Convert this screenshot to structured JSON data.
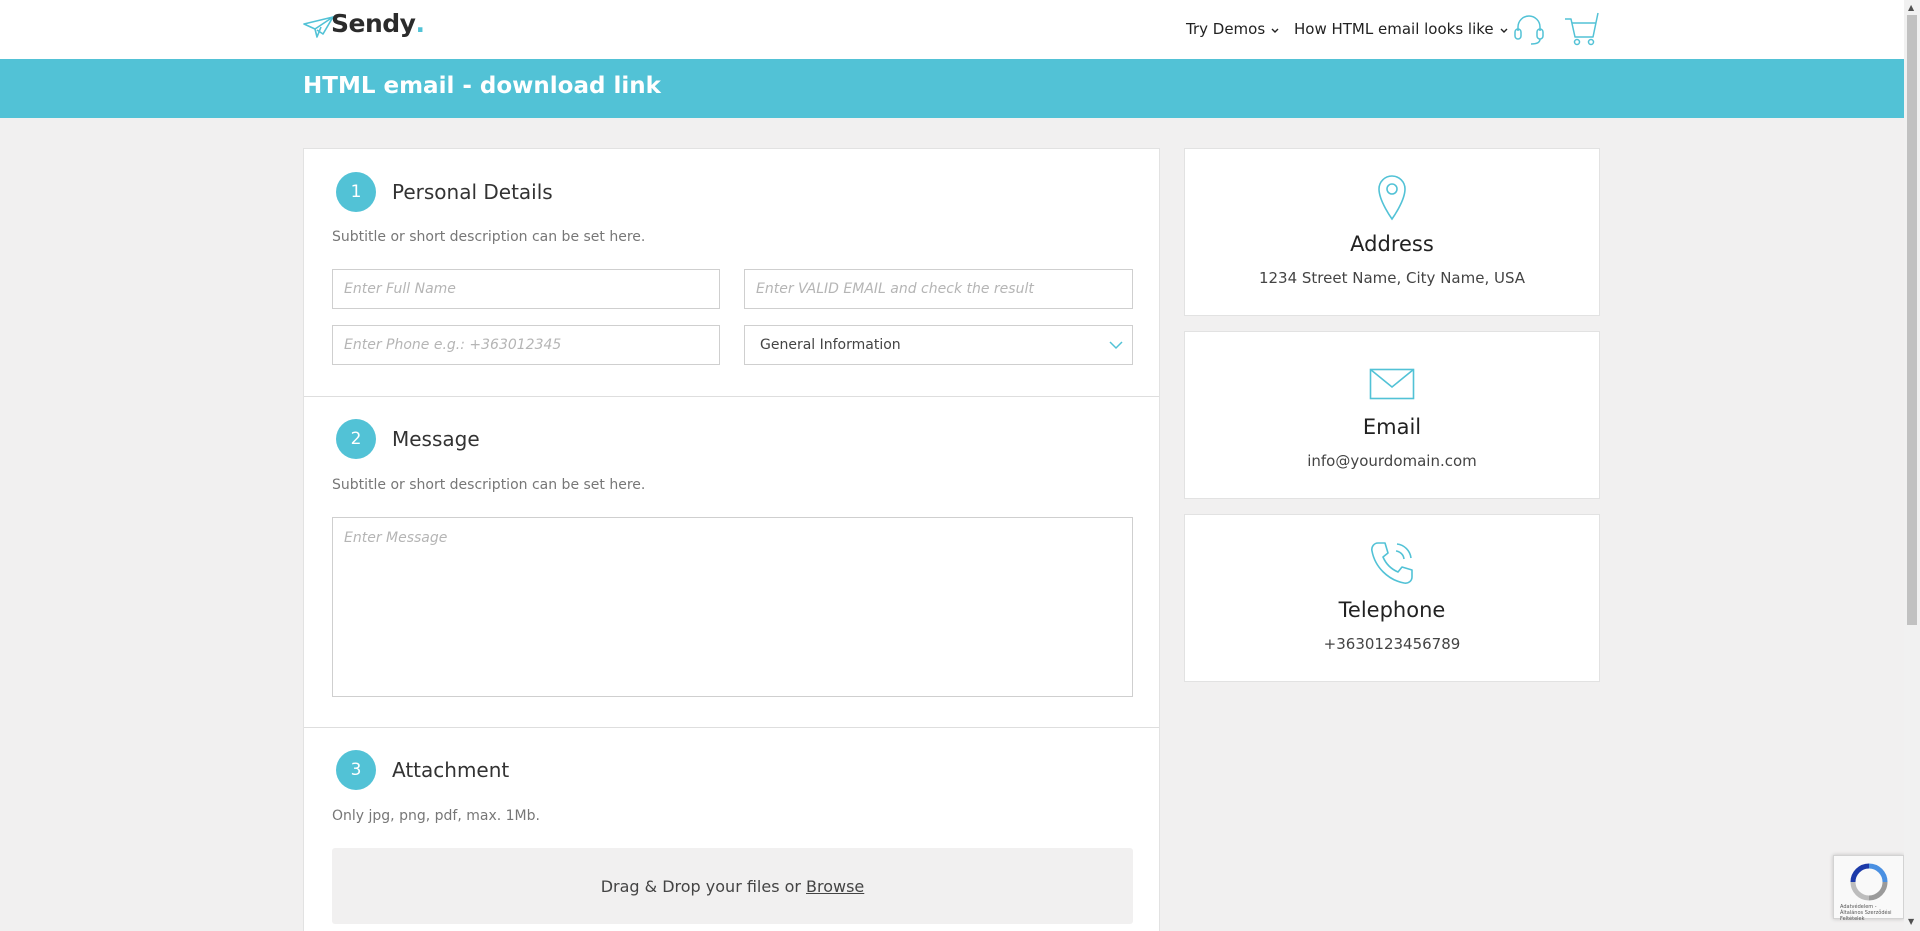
{
  "header": {
    "logo_text": "Sendy",
    "logo_dot": ".",
    "nav": [
      {
        "label": "Try Demos",
        "chevron": "⌄"
      },
      {
        "label": "How HTML email looks like",
        "chevron": "⌄"
      }
    ],
    "icons": [
      "headset-icon",
      "cart-icon"
    ]
  },
  "banner": {
    "title": "HTML email - download link"
  },
  "form": {
    "sections": [
      {
        "step": "1",
        "title": "Personal Details",
        "subtitle": "Subtitle or short description can be set here."
      },
      {
        "step": "2",
        "title": "Message",
        "subtitle": "Subtitle or short description can be set here."
      },
      {
        "step": "3",
        "title": "Attachment",
        "subtitle": "Only jpg, png, pdf, max. 1Mb."
      }
    ],
    "fields": {
      "full_name_placeholder": "Enter Full Name",
      "email_placeholder": "Enter VALID EMAIL and check the result",
      "phone_placeholder": "Enter Phone e.g.: +363012345",
      "topic_selected": "General Information",
      "message_placeholder": "Enter Message"
    },
    "dropzone": {
      "text": "Drag & Drop your files or",
      "browse": "Browse"
    }
  },
  "contact": [
    {
      "icon": "location-pin-icon",
      "label": "Address",
      "value": "1234 Street Name, City Name, USA"
    },
    {
      "icon": "envelope-icon",
      "label": "Email",
      "value": "info@yourdomain.com"
    },
    {
      "icon": "phone-icon",
      "label": "Telephone",
      "value": "+3630123456789"
    }
  ],
  "recaptcha": {
    "text": "Adatvédelem - Általános Szerződési Feltételek"
  },
  "colors": {
    "accent": "#52c2d6",
    "background": "#f1f0f0"
  }
}
